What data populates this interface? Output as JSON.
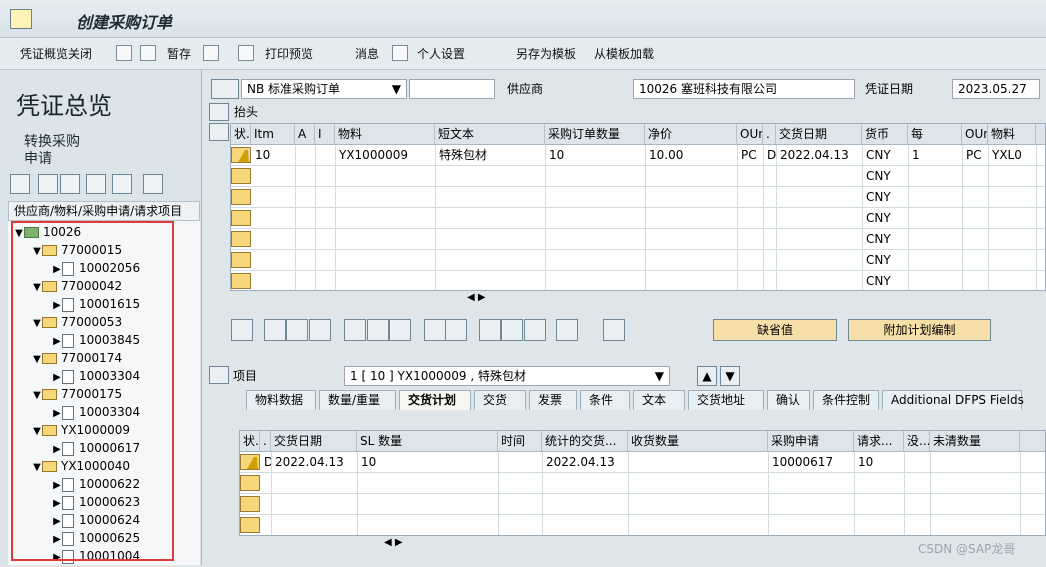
{
  "app": {
    "title": "创建采购订单"
  },
  "toolbar": {
    "items": [
      {
        "label": "凭证概览关闭"
      },
      {
        "label": "暂存"
      },
      {
        "label": "打印预览"
      },
      {
        "label": "消息"
      },
      {
        "label": "个人设置"
      },
      {
        "label": "另存为模板"
      },
      {
        "label": "从模板加载"
      }
    ]
  },
  "left": {
    "title": "凭证总览",
    "text1": "转换采购",
    "text2": "申请",
    "tree_header": "供应商/物料/采购申请/请求项目",
    "tree": [
      {
        "kind": "supplier",
        "text": "10026",
        "level": 0,
        "expanded": true
      },
      {
        "kind": "group",
        "text": "77000015",
        "level": 1,
        "expanded": true
      },
      {
        "kind": "item",
        "text": "10002056",
        "level": 2
      },
      {
        "kind": "group",
        "text": "77000042",
        "level": 1,
        "expanded": true
      },
      {
        "kind": "item",
        "text": "10001615",
        "level": 2
      },
      {
        "kind": "group",
        "text": "77000053",
        "level": 1,
        "expanded": true
      },
      {
        "kind": "item",
        "text": "10003845",
        "level": 2
      },
      {
        "kind": "group",
        "text": "77000174",
        "level": 1,
        "expanded": true
      },
      {
        "kind": "item",
        "text": "10003304",
        "level": 2
      },
      {
        "kind": "group",
        "text": "77000175",
        "level": 1,
        "expanded": true
      },
      {
        "kind": "item",
        "text": "10003304",
        "level": 2
      },
      {
        "kind": "group",
        "text": "YX1000009",
        "level": 1,
        "expanded": true
      },
      {
        "kind": "item",
        "text": "10000617",
        "level": 2
      },
      {
        "kind": "group",
        "text": "YX1000040",
        "level": 1,
        "expanded": true
      },
      {
        "kind": "item",
        "text": "10000622",
        "level": 2
      },
      {
        "kind": "item",
        "text": "10000623",
        "level": 2
      },
      {
        "kind": "item",
        "text": "10000624",
        "level": 2
      },
      {
        "kind": "item",
        "text": "10000625",
        "level": 2
      },
      {
        "kind": "item",
        "text": "10001004",
        "level": 2
      }
    ]
  },
  "header": {
    "po_type": "NB 标准采购订单",
    "vendor_label": "供应商",
    "vendor_value": "10026 塞班科技有限公司",
    "date_label": "凭证日期",
    "date_value": "2023.05.27",
    "head_label": "抬头"
  },
  "grid1": {
    "headers": [
      "状.",
      "Itm",
      "A",
      "I",
      "物料",
      "短文本",
      "采购订单数量",
      "净价",
      "OUn",
      ".",
      "交货日期",
      "货币",
      "每",
      "OUn",
      "物料"
    ],
    "rows": [
      [
        "",
        "10",
        "",
        "",
        "YX1000009",
        "特殊包材",
        "10",
        "10.00",
        "PC",
        "D",
        "2022.04.13",
        "CNY",
        "1",
        "PC",
        "YXL0"
      ],
      [
        "",
        "",
        "",
        "",
        "",
        "",
        "",
        "",
        "",
        "",
        "",
        "CNY",
        "",
        "",
        ""
      ],
      [
        "",
        "",
        "",
        "",
        "",
        "",
        "",
        "",
        "",
        "",
        "",
        "CNY",
        "",
        "",
        ""
      ],
      [
        "",
        "",
        "",
        "",
        "",
        "",
        "",
        "",
        "",
        "",
        "",
        "CNY",
        "",
        "",
        ""
      ],
      [
        "",
        "",
        "",
        "",
        "",
        "",
        "",
        "",
        "",
        "",
        "",
        "CNY",
        "",
        "",
        ""
      ],
      [
        "",
        "",
        "",
        "",
        "",
        "",
        "",
        "",
        "",
        "",
        "",
        "CNY",
        "",
        "",
        ""
      ],
      [
        "",
        "",
        "",
        "",
        "",
        "",
        "",
        "",
        "",
        "",
        "",
        "CNY",
        "",
        "",
        ""
      ]
    ]
  },
  "buttons": {
    "default_values": "缺省值",
    "additional_plan": "附加计划编制"
  },
  "item": {
    "label": "项目",
    "value": "1 [ 10 ] YX1000009 , 特殊包材"
  },
  "tabs": [
    "物料数据",
    "数量/重量",
    "交货计划",
    "交货",
    "发票",
    "条件",
    "文本",
    "交货地址",
    "确认",
    "条件控制",
    "Additional DFPS Fields"
  ],
  "grid2": {
    "headers": [
      "状.",
      ".",
      "交货日期",
      "SL 数量",
      "时间",
      "统计的交货...",
      "收货数量",
      "采购申请",
      "请求...",
      "没...",
      "未清数量"
    ],
    "rows": [
      [
        "",
        "D",
        "2022.04.13",
        "10",
        "",
        "2022.04.13",
        "",
        "10000617",
        "10",
        "",
        ""
      ],
      [
        "",
        "",
        "",
        "",
        "",
        "",
        "",
        "",
        "",
        "",
        ""
      ],
      [
        "",
        "",
        "",
        "",
        "",
        "",
        "",
        "",
        "",
        "",
        ""
      ],
      [
        "",
        "",
        "",
        "",
        "",
        "",
        "",
        "",
        "",
        "",
        ""
      ]
    ]
  },
  "watermark": "CSDN @SAP龙哥"
}
